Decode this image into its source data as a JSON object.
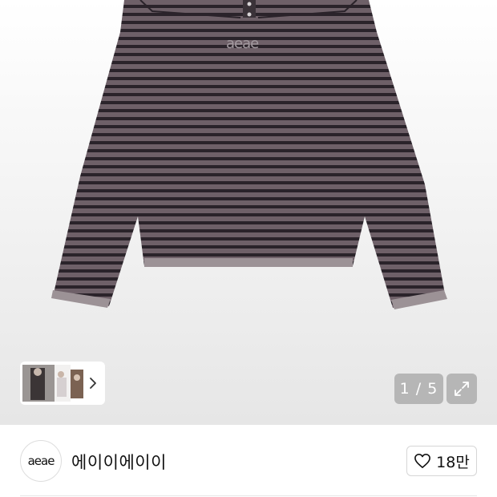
{
  "gallery": {
    "product_image_label": "aeae",
    "counter": "1 / 5"
  },
  "brand": {
    "logo_text": "aeae",
    "name": "에이이에이이",
    "like_count": "18만"
  }
}
